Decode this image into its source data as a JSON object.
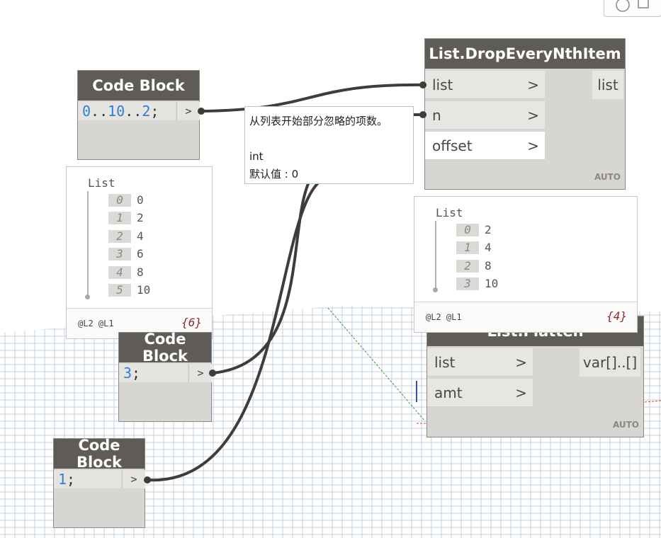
{
  "nodes": {
    "cb1": {
      "title": "Code Block",
      "code_num1": "0",
      "code_dots1": "..",
      "code_num2": "10",
      "code_dots2": "..",
      "code_num3": "2",
      "code_end": ";",
      "out": ">"
    },
    "cb2": {
      "title": "Code Block",
      "code_num": "3",
      "code_end": ";",
      "out": ">"
    },
    "cb3": {
      "title": "Code Block",
      "code_num": "1",
      "code_end": ";",
      "out": ">"
    },
    "drop": {
      "title": "List.DropEveryNthItem",
      "inputs": [
        "list",
        "n",
        "offset"
      ],
      "output": "list",
      "lacing": "AUTO"
    },
    "flatten": {
      "title": "List.Flatten",
      "inputs": [
        "list",
        "amt"
      ],
      "output": "var[]..[]",
      "lacing": "AUTO"
    }
  },
  "previews": {
    "p1": {
      "title": "List",
      "items": [
        {
          "i": "0",
          "v": "0"
        },
        {
          "i": "1",
          "v": "2"
        },
        {
          "i": "2",
          "v": "4"
        },
        {
          "i": "3",
          "v": "6"
        },
        {
          "i": "4",
          "v": "8"
        },
        {
          "i": "5",
          "v": "10"
        }
      ],
      "levels": "@L2 @L1",
      "count": "{6}"
    },
    "p2": {
      "title": "List",
      "items": [
        {
          "i": "0",
          "v": "2"
        },
        {
          "i": "1",
          "v": "4"
        },
        {
          "i": "2",
          "v": "8"
        },
        {
          "i": "3",
          "v": "10"
        }
      ],
      "levels": "@L2 @L1",
      "count": "{4}"
    }
  },
  "tooltip": {
    "line1": "从列表开始部分忽略的项数。",
    "line2": "",
    "line3": "int",
    "line4": "默认值 : 0"
  },
  "chevron": ">",
  "colors": {
    "header": "#5f5c58",
    "wire": "#3f3d3b",
    "code_number": "#2e7fd6",
    "grid": "#b8cadb"
  }
}
